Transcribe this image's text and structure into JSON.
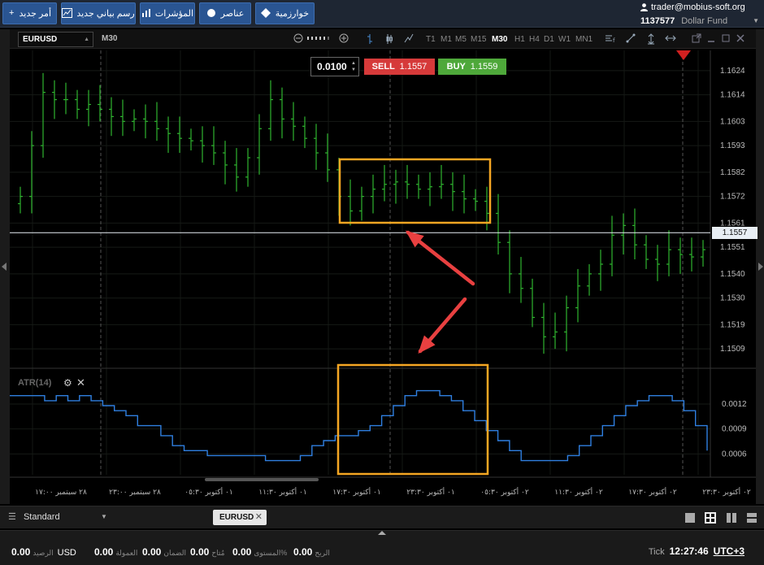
{
  "toolbar": {
    "new_order": "أمر جديد",
    "new_chart": "رسم بياني جديد",
    "indicators": "المؤشرات",
    "elements": "عناصر",
    "algorithms": "خوارزمية"
  },
  "account": {
    "user": "trader@mobius-soft.org",
    "id": "1137577",
    "fund": "Dollar Fund"
  },
  "chart_toolbar": {
    "symbol": "EURUSD",
    "timeframe": "M30",
    "timeframes": [
      "T1",
      "M1",
      "M5",
      "M15",
      "M30",
      "H1",
      "H4",
      "D1",
      "W1",
      "MN1"
    ],
    "active_timeframe": "M30"
  },
  "order_panel": {
    "lot": "0.0100",
    "sell_label": "SELL",
    "sell_price": "1.1557",
    "buy_label": "BUY",
    "buy_price": "1.1559"
  },
  "current_price": "1.1557",
  "indicator": {
    "name": "ATR(14)"
  },
  "chart_data": [
    {
      "type": "bar",
      "series": [
        {
          "name": "EURUSD M30",
          "values": [
            1.1572,
            1.1593,
            1.1615,
            1.1612,
            1.1612,
            1.1608,
            1.161,
            1.1608,
            1.1605,
            1.1603,
            1.1604,
            1.1603,
            1.16,
            1.1598,
            1.1596,
            1.1595,
            1.1593,
            1.159,
            1.1585,
            1.158,
            1.1588,
            1.16,
            1.1612,
            1.1604,
            1.1601,
            1.1596,
            1.159,
            1.1583,
            1.1572,
            1.1566,
            1.1572,
            1.1575,
            1.1577,
            1.1578,
            1.1577,
            1.1575,
            1.1576,
            1.1577,
            1.1574,
            1.1571,
            1.157,
            1.1565,
            1.1553,
            1.154,
            1.1534,
            1.1522,
            1.1514,
            1.1516,
            1.1526,
            1.1535,
            1.154,
            1.1544,
            1.1556,
            1.156,
            1.1552,
            1.1546,
            1.1544,
            1.155,
            1.1548,
            1.1547,
            1.155
          ]
        }
      ],
      "y_ticks": [
        "1.1624",
        "1.1614",
        "1.1603",
        "1.1593",
        "1.1582",
        "1.1572",
        "1.1561",
        "1.1551",
        "1.1540",
        "1.1530",
        "1.1519",
        "1.1509"
      ],
      "ylim": [
        1.1502,
        1.1631
      ],
      "x_ticks": [
        "٢٨ سبتمبر ١٧:٠٠",
        "٢٨ سبتمبر ٢٣:٠٠",
        "٠١ أكتوبر ٠٥:٣٠",
        "٠١ أكتوبر ١١:٣٠",
        "٠١ أكتوبر ١٧:٣٠",
        "٠١ أكتوبر ٢٣:٣٠",
        "٠٢ أكتوبر ٠٥:٣٠",
        "٠٢ أكتوبر ١١:٣٠",
        "٠٢ أكتوبر ١٧:٣٠",
        "٠٢ أكتوبر ٢٣:٣٠"
      ]
    },
    {
      "type": "line",
      "series": [
        {
          "name": "ATR(14)",
          "values": [
            0.0013,
            0.0013,
            0.0013,
            0.00124,
            0.0013,
            0.00124,
            0.0013,
            0.00124,
            0.00118,
            0.00112,
            0.00106,
            0.00094,
            0.00094,
            0.00082,
            0.0007,
            0.00064,
            0.00064,
            0.00058,
            0.00058,
            0.00058,
            0.00058,
            0.00058,
            0.00052,
            0.00052,
            0.00052,
            0.00058,
            0.0007,
            0.00076,
            0.00082,
            0.00082,
            0.00088,
            0.00094,
            0.00106,
            0.00118,
            0.0013,
            0.00136,
            0.00136,
            0.0013,
            0.00124,
            0.00112,
            0.001,
            0.00088,
            0.00076,
            0.00064,
            0.00052,
            0.00052,
            0.00052,
            0.00052,
            0.00058,
            0.0007,
            0.00082,
            0.00094,
            0.00106,
            0.00118,
            0.00124,
            0.0013,
            0.0013,
            0.00124,
            0.00112,
            0.00094,
            0.00064
          ]
        }
      ],
      "y_ticks": [
        "0.0012",
        "0.0009",
        "0.0006"
      ],
      "ylim": [
        0.00035,
        0.0016
      ]
    }
  ],
  "tabs": {
    "layout": "Standard",
    "symbol_tab": "EURUSD"
  },
  "status": {
    "balance_value": "0.00",
    "balance_currency": "USD",
    "balance_label": "الرصيد",
    "commission_value": "0.00",
    "commission_label": "العمولة",
    "margin_value": "0.00",
    "margin_label": "الضمان",
    "free_value": "0.00",
    "free_label": "مُتاح",
    "level_value": "0.00",
    "level_label": "المستوى%",
    "profit_value": "0.00",
    "profit_label": "الربح",
    "tick_label": "Tick",
    "time": "12:27:46",
    "timezone": "UTC+3"
  },
  "colors": {
    "bar_up": "#2fb52f",
    "atr_line": "#2f7fe0",
    "highlight": "#f5a623",
    "arrow": "#e84040",
    "toolbar_button": "#2a5592"
  }
}
